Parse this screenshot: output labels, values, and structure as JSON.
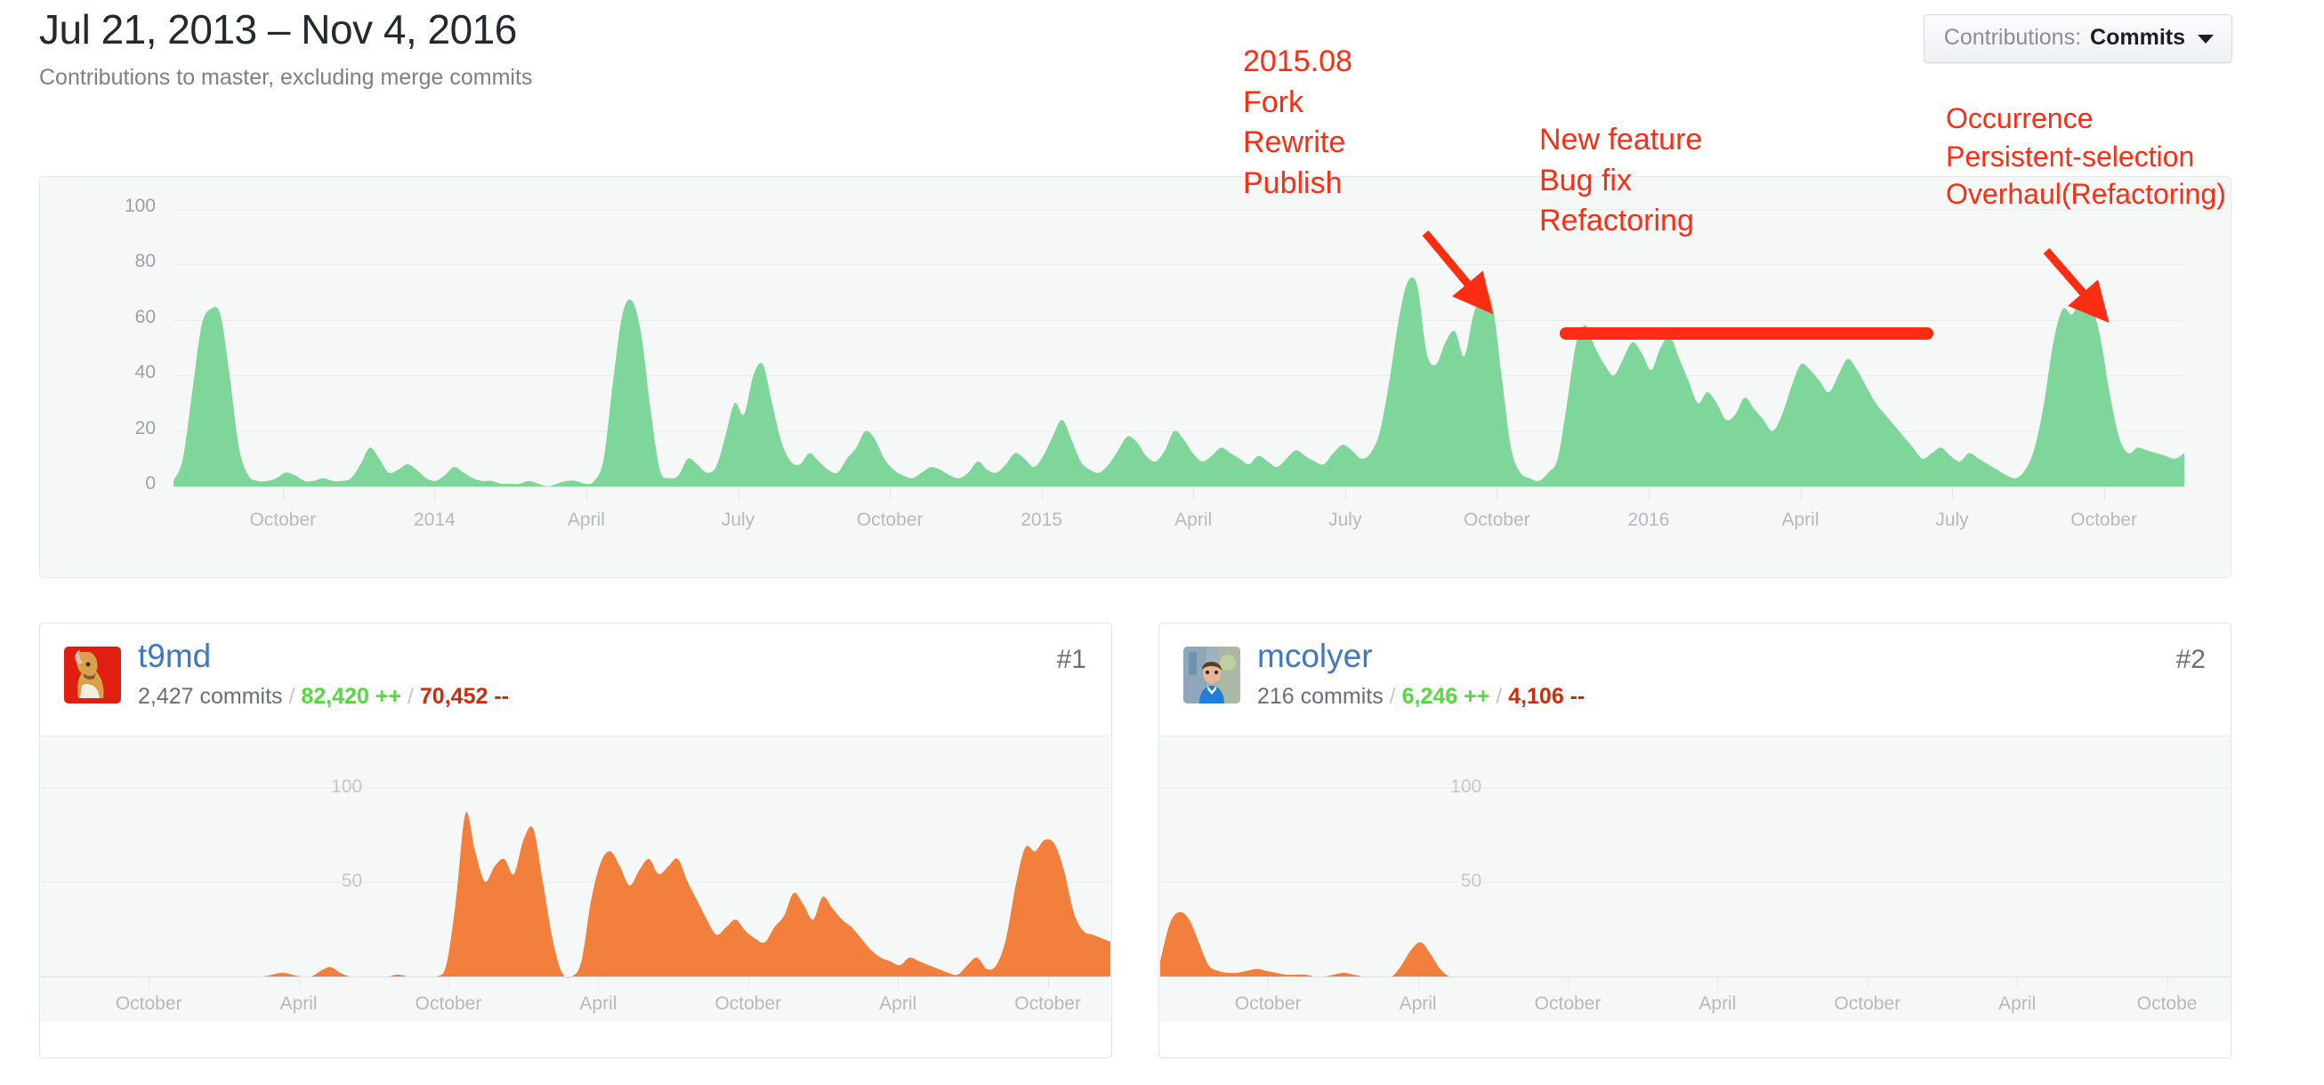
{
  "header": {
    "title": "Jul 21, 2013 – Nov 4, 2016",
    "subtitle": "Contributions to master, excluding merge commits",
    "selector": {
      "label": "Contributions:",
      "value": "Commits",
      "caret_icon": "chevron-down-icon"
    }
  },
  "annotations": {
    "left_block": [
      "2015.08",
      "Fork",
      "Rewrite",
      "Publish"
    ],
    "mid_block": [
      "New feature",
      "Bug fix",
      "Refactoring"
    ],
    "right_block": [
      "Occurrence",
      "Persistent-selection",
      "Overhaul(Refactoring)"
    ],
    "color": "#fc2d12",
    "arrows": [
      "arrow-down-right-icon",
      "arrow-down-right-icon"
    ],
    "underline": "refactoring-period-underline"
  },
  "chart_data": [
    {
      "id": "main-contributions-chart",
      "type": "area",
      "title": "Contributions to master, excluding merge commits",
      "xlabel": "",
      "ylabel": "",
      "ylim": [
        0,
        100
      ],
      "yticks": [
        0,
        20,
        40,
        60,
        80,
        100
      ],
      "grid": true,
      "legend": "none",
      "color": "#7fd69a",
      "xtick_labels": [
        "October",
        "2014",
        "April",
        "July",
        "October",
        "2015",
        "April",
        "July",
        "October",
        "2016",
        "April",
        "July",
        "October"
      ],
      "x_start": "Jul 21, 2013",
      "x_end": "Nov 4, 2016",
      "values": [
        2,
        10,
        34,
        58,
        64,
        62,
        40,
        14,
        4,
        2,
        2,
        3,
        5,
        4,
        2,
        2,
        3,
        2,
        2,
        3,
        8,
        14,
        10,
        5,
        6,
        8,
        6,
        3,
        2,
        4,
        7,
        5,
        3,
        2,
        2,
        1,
        1,
        1,
        2,
        1,
        0,
        1,
        2,
        2,
        1,
        2,
        10,
        38,
        62,
        67,
        55,
        28,
        6,
        3,
        4,
        10,
        8,
        5,
        7,
        18,
        30,
        26,
        40,
        44,
        30,
        16,
        9,
        8,
        12,
        9,
        6,
        5,
        10,
        14,
        20,
        17,
        10,
        6,
        4,
        3,
        5,
        7,
        6,
        4,
        3,
        5,
        9,
        6,
        5,
        8,
        12,
        10,
        7,
        11,
        18,
        24,
        17,
        9,
        6,
        5,
        8,
        13,
        18,
        16,
        11,
        9,
        13,
        20,
        17,
        12,
        9,
        11,
        14,
        12,
        10,
        8,
        11,
        9,
        7,
        10,
        13,
        11,
        9,
        8,
        12,
        15,
        13,
        10,
        12,
        20,
        38,
        60,
        74,
        72,
        48,
        44,
        52,
        56,
        47,
        62,
        70,
        66,
        40,
        14,
        5,
        3,
        2,
        5,
        10,
        30,
        52,
        58,
        50,
        44,
        40,
        46,
        52,
        48,
        42,
        50,
        54,
        46,
        38,
        30,
        34,
        30,
        24,
        26,
        32,
        28,
        24,
        20,
        26,
        36,
        44,
        42,
        38,
        34,
        40,
        46,
        42,
        36,
        30,
        26,
        22,
        18,
        14,
        10,
        12,
        14,
        11,
        9,
        12,
        10,
        8,
        6,
        4,
        3,
        6,
        14,
        30,
        52,
        64,
        62,
        68,
        66,
        54,
        34,
        18,
        12,
        14,
        13,
        12,
        11,
        10,
        12
      ]
    },
    {
      "id": "t9md-chart",
      "type": "area",
      "ylim": [
        0,
        120
      ],
      "yticks": [
        50,
        100
      ],
      "grid": true,
      "color": "#f2803c",
      "xtick_labels": [
        "October",
        "April",
        "October",
        "April",
        "October",
        "April",
        "October"
      ],
      "values": [
        0,
        0,
        0,
        0,
        0,
        0,
        0,
        0,
        0,
        0,
        0,
        0,
        0,
        0,
        0,
        0,
        0,
        0,
        0,
        0,
        0,
        0,
        0,
        0,
        1,
        2,
        1,
        0,
        0,
        3,
        5,
        2,
        0,
        0,
        0,
        0,
        0,
        1,
        0,
        0,
        0,
        0,
        6,
        40,
        86,
        66,
        50,
        58,
        62,
        54,
        72,
        78,
        50,
        20,
        2,
        0,
        8,
        40,
        60,
        66,
        58,
        48,
        56,
        62,
        54,
        58,
        62,
        50,
        40,
        30,
        22,
        26,
        30,
        24,
        20,
        18,
        26,
        32,
        44,
        38,
        30,
        42,
        36,
        30,
        26,
        20,
        14,
        10,
        8,
        6,
        10,
        8,
        6,
        4,
        2,
        1,
        6,
        10,
        4,
        6,
        20,
        48,
        68,
        66,
        72,
        70,
        56,
        34,
        24,
        22,
        20,
        18
      ]
    },
    {
      "id": "mcolyer-chart",
      "type": "area",
      "ylim": [
        0,
        120
      ],
      "yticks": [
        50,
        100
      ],
      "grid": true,
      "color": "#f2803c",
      "xtick_labels": [
        "October",
        "April",
        "October",
        "April",
        "October",
        "April",
        "Octobe"
      ],
      "values": [
        8,
        28,
        34,
        30,
        18,
        6,
        3,
        2,
        2,
        3,
        4,
        3,
        2,
        1,
        1,
        1,
        0,
        0,
        1,
        2,
        1,
        0,
        0,
        0,
        0,
        6,
        14,
        18,
        12,
        4,
        0,
        0,
        0,
        0,
        0,
        0,
        0,
        0,
        0,
        0,
        0,
        0,
        0,
        0,
        0,
        0,
        0,
        0,
        0,
        0,
        0,
        0,
        0,
        0,
        0,
        0,
        0,
        0,
        0,
        0,
        0,
        0,
        0,
        0,
        0,
        0,
        0,
        0,
        0,
        0,
        0,
        0,
        0,
        0,
        0,
        0,
        0,
        0,
        0,
        0,
        0,
        0,
        0,
        0,
        0,
        0,
        0,
        0,
        0,
        0,
        0,
        0,
        0,
        0,
        0,
        0,
        0,
        0,
        0,
        0,
        0,
        0,
        0,
        0,
        0,
        0,
        0,
        0,
        0,
        0,
        0,
        0
      ]
    }
  ],
  "contributors": [
    {
      "username": "t9md",
      "rank": "#1",
      "commits": "2,427 commits",
      "additions": "82,420 ++",
      "deletions": "70,452 --",
      "avatar": "avatar-t9md"
    },
    {
      "username": "mcolyer",
      "rank": "#2",
      "commits": "216 commits",
      "additions": "6,246 ++",
      "deletions": "4,106 --",
      "avatar": "avatar-mcolyer"
    }
  ]
}
